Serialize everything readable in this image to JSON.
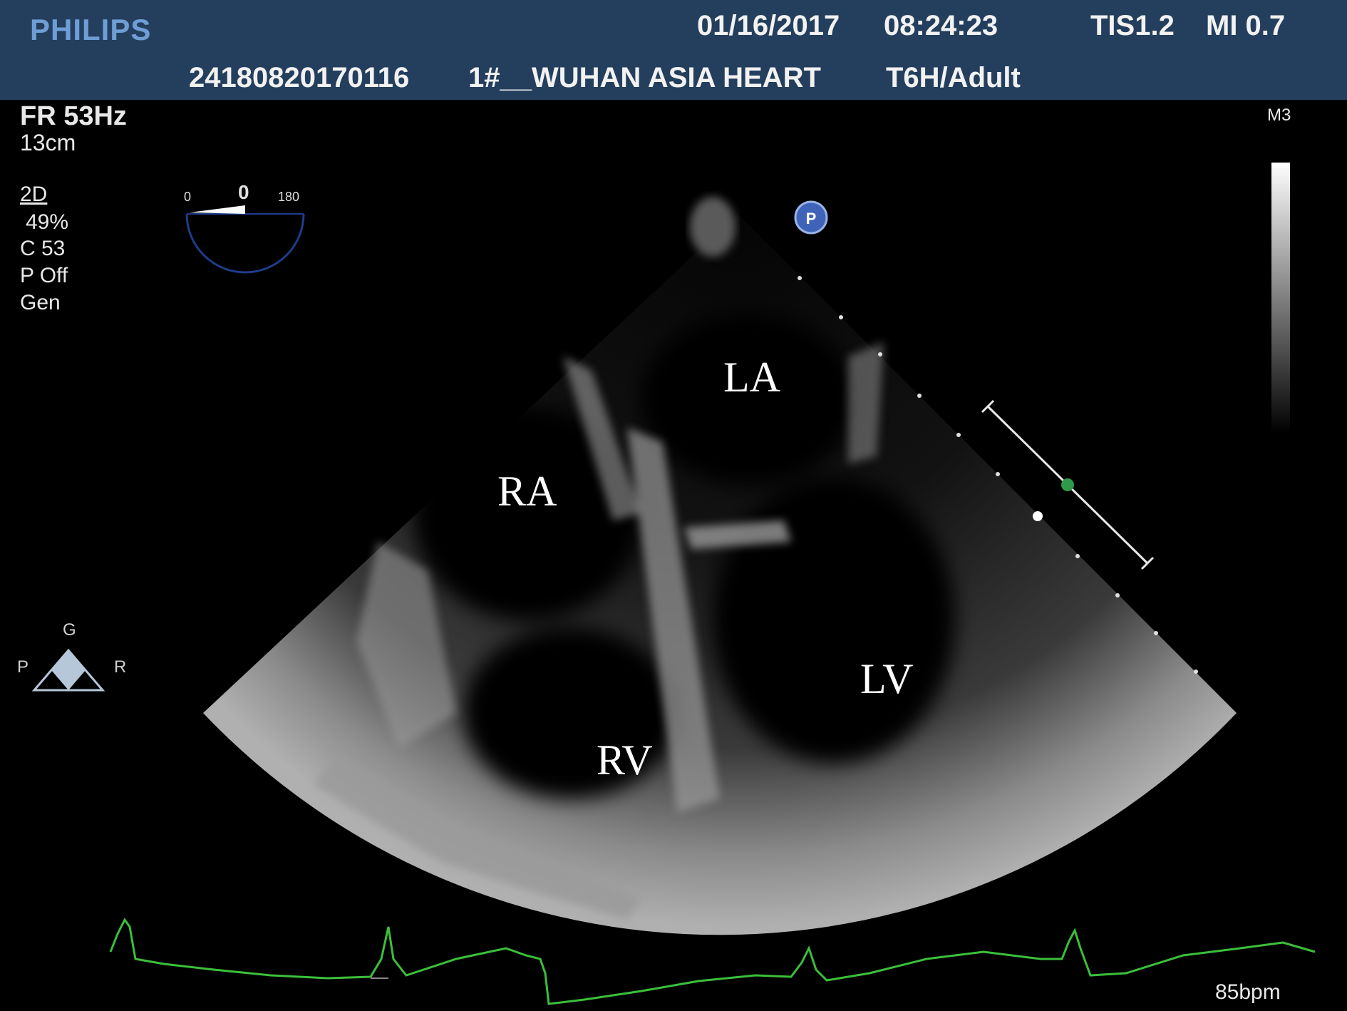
{
  "header": {
    "brand": "PHILIPS",
    "date": "01/16/2017",
    "time": "08:24:23",
    "tis": "TIS1.2",
    "mi": "MI 0.7",
    "patient_id": "24180820170116",
    "institution": "1#__WUHAN ASIA HEART",
    "probe": "T6H/Adult"
  },
  "left_panel": {
    "frame_rate": "FR 53Hz",
    "depth": "13cm",
    "mode": "2D",
    "gain": "49%",
    "compression": "C 53",
    "persistence": "P Off",
    "preset": "Gen"
  },
  "angle_indicator": {
    "min": "0",
    "value": "0",
    "max": "180"
  },
  "orientation": {
    "top": "G",
    "left": "P",
    "right": "R"
  },
  "grayscale_map": "M3",
  "chambers": {
    "la": "LA",
    "ra": "RA",
    "lv": "LV",
    "rv": "RV"
  },
  "ecg": {
    "heart_rate": "85bpm",
    "trace_color": "#3bbf3b"
  },
  "colors": {
    "header_bg": "#243f5d",
    "brand": "#6f9ed6",
    "marker_green": "#2f9a4a",
    "angle_arc": "#1f3c8a"
  }
}
